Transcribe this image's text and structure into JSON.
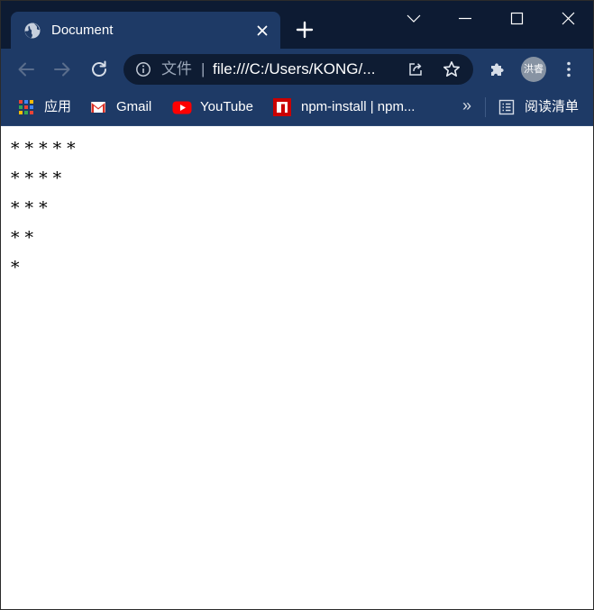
{
  "window": {
    "tab_title": "Document",
    "tab_favicon": "globe-icon"
  },
  "toolbar": {
    "scheme_label": "文件",
    "separator": "|",
    "url": "file:///C:/Users/KONG/..."
  },
  "profile": {
    "avatar_text": "洪睿"
  },
  "bookmarks": {
    "items": [
      {
        "label": "应用",
        "icon": "apps-grid-icon"
      },
      {
        "label": "Gmail",
        "icon": "gmail-icon"
      },
      {
        "label": "YouTube",
        "icon": "youtube-icon"
      },
      {
        "label": "npm-install | npm...",
        "icon": "npm-icon"
      }
    ],
    "more": "»",
    "reading_list": "阅读清单"
  },
  "page": {
    "lines": [
      "* * * * *",
      "* * * *",
      "* * *",
      "* *",
      "*"
    ]
  },
  "colors": {
    "titlebar": "#0d1b33",
    "toolbar": "#1e3a66",
    "omnibox": "#0e1c33",
    "youtube_red": "#ff0000",
    "npm_red": "#cb0000"
  }
}
